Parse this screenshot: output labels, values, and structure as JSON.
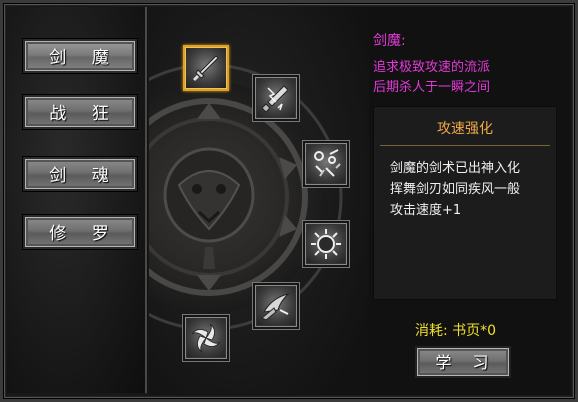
{
  "tabs": [
    {
      "label": "剑 魔",
      "active": true
    },
    {
      "label": "战 狂",
      "active": false
    },
    {
      "label": "剑 魂",
      "active": false
    },
    {
      "label": "修 罗",
      "active": false
    }
  ],
  "class_info": {
    "name": "剑魔:",
    "desc": [
      "追求极致攻速的流派",
      "后期杀人于一瞬之间"
    ]
  },
  "skill": {
    "title": "攻速强化",
    "lines": [
      "剑魔的剑术已出神入化",
      "挥舞剑刃如同疾风一般",
      "攻击速度+1"
    ]
  },
  "cost": "消耗: 书页*0",
  "learn_button": "学 习",
  "skill_icons": [
    {
      "name": "sword-icon",
      "selected": true
    },
    {
      "name": "lightning-sword-icon",
      "selected": false
    },
    {
      "name": "scatter-blades-icon",
      "selected": false
    },
    {
      "name": "spiked-ring-icon",
      "selected": false
    },
    {
      "name": "winged-blade-icon",
      "selected": false
    },
    {
      "name": "whirlwind-icon",
      "selected": false
    }
  ],
  "colors": {
    "class_text": "#e23ad8",
    "skill_title": "#f0a848",
    "cost_text": "#f0e030",
    "selected_border": "#e0a020"
  }
}
